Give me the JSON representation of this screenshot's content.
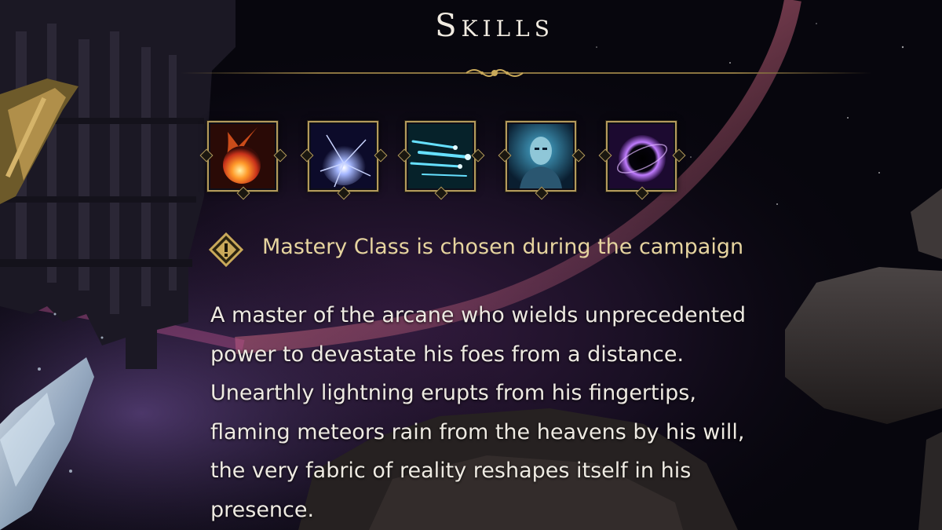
{
  "screen": {
    "title": "Skills"
  },
  "skills": [
    {
      "icon": "fireball-icon"
    },
    {
      "icon": "lightning-orb-icon"
    },
    {
      "icon": "arcane-bolts-icon"
    },
    {
      "icon": "mage-portrait-icon"
    },
    {
      "icon": "black-hole-icon"
    }
  ],
  "notice": {
    "icon": "exclamation-diamond-icon",
    "text": "Mastery Class is chosen during the campaign"
  },
  "description": {
    "lines": [
      "A master of the arcane who wields unprecedented",
      "power to devastate his foes from a distance.",
      "Unearthly lightning erupts from his fingertips,",
      "flaming meteors rain from the heavens by his will,",
      "the very fabric of reality reshapes itself in his",
      "presence."
    ]
  },
  "colors": {
    "gold": "#b49b5c",
    "notice_text": "#e6d49f",
    "body_text": "#eeeae2",
    "title_text": "#f1ebe1"
  }
}
